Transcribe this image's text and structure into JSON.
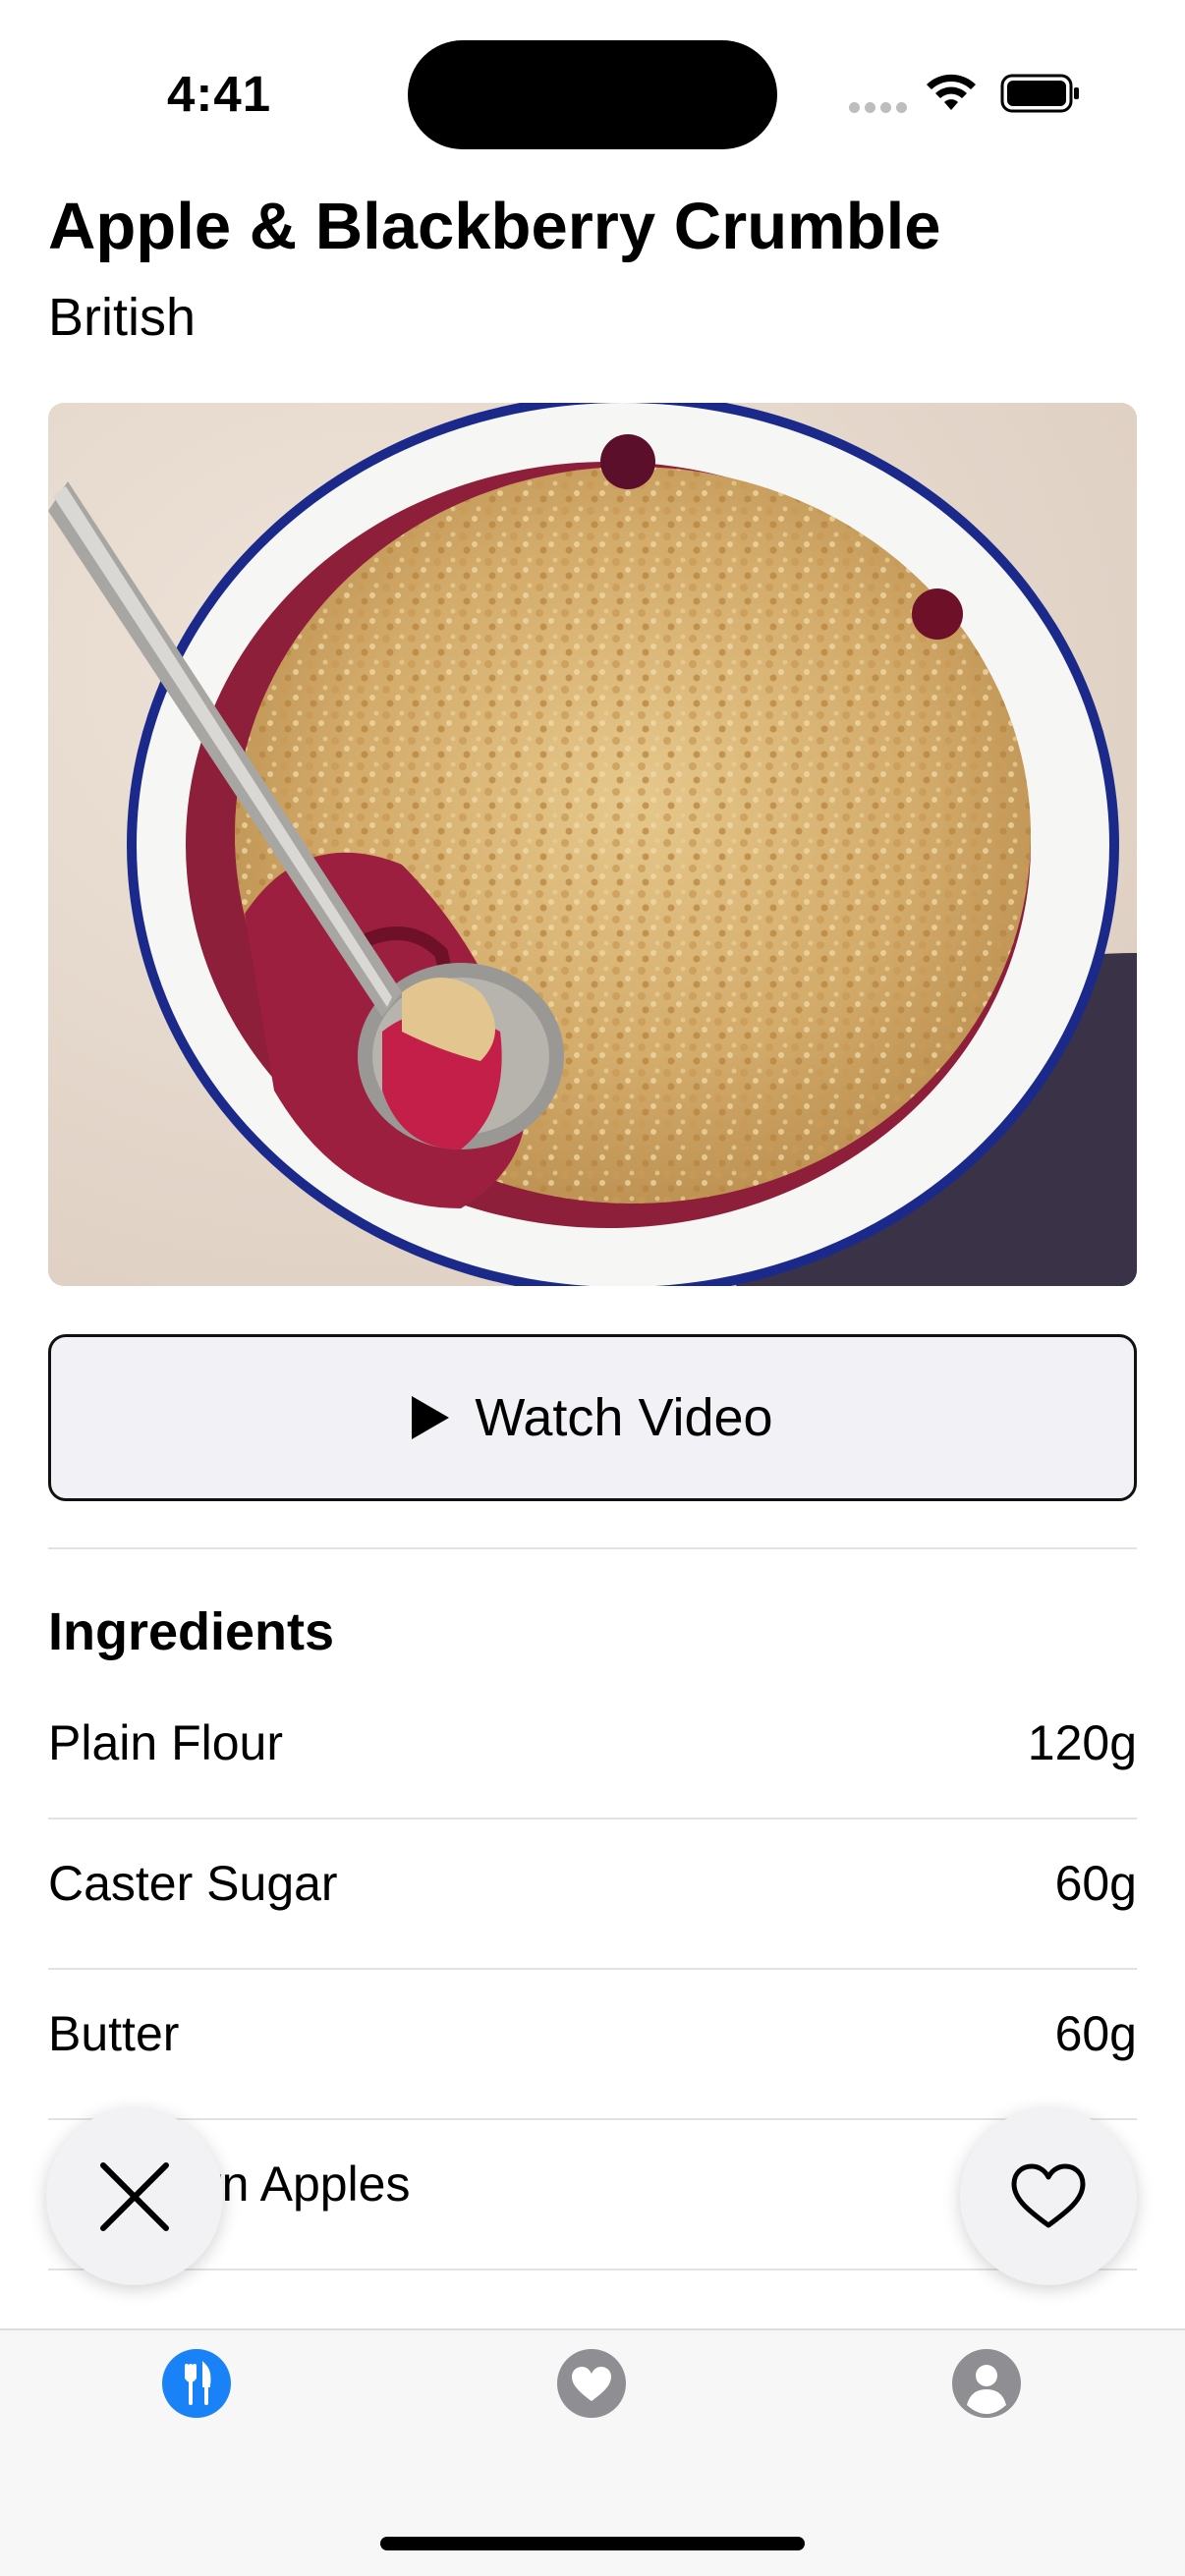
{
  "status_bar": {
    "time": "4:41"
  },
  "recipe": {
    "title": "Apple & Blackberry Crumble",
    "cuisine": "British"
  },
  "hero_image": {
    "alt": "",
    "icon": "crumble-photo"
  },
  "watch_video": {
    "label": "Watch Video",
    "icon": "play-icon"
  },
  "ingredients": {
    "heading": "Ingredients",
    "items": [
      {
        "name": "Plain Flour",
        "qty": "120g"
      },
      {
        "name": "Caster Sugar",
        "qty": "60g"
      },
      {
        "name": "Butter",
        "qty": "60g"
      },
      {
        "name": "rn Apples",
        "qty": ""
      }
    ]
  },
  "fabs": {
    "close_icon": "close-icon",
    "favorite_icon": "heart-outline-icon"
  },
  "tabbar": {
    "tabs": [
      {
        "icon": "fork-knife-icon",
        "active": true
      },
      {
        "icon": "heart-icon",
        "active": false
      },
      {
        "icon": "person-icon",
        "active": false
      }
    ]
  },
  "colors": {
    "accent": "#1a82f7",
    "inactive_tab": "#8e8e93",
    "button_bg": "#f2f2f6",
    "divider": "#e2e2e2"
  }
}
